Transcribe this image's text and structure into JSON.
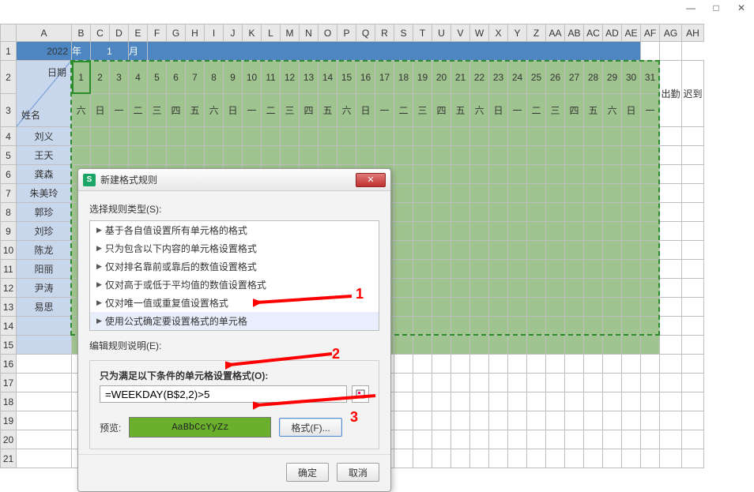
{
  "window_controls": {
    "minimize": "—",
    "maximize": "□",
    "close": "✕"
  },
  "colheaders": [
    "",
    "A",
    "B",
    "C",
    "D",
    "E",
    "F",
    "G",
    "H",
    "I",
    "J",
    "K",
    "L",
    "M",
    "N",
    "O",
    "P",
    "Q",
    "R",
    "S",
    "T",
    "U",
    "V",
    "W",
    "X",
    "Y",
    "Z",
    "AA",
    "AB",
    "AC",
    "AD",
    "AE",
    "AF",
    "AG",
    "AH"
  ],
  "rownums": [
    "1",
    "2",
    "3",
    "4",
    "5",
    "6",
    "7",
    "8",
    "9",
    "10",
    "11",
    "12",
    "13",
    "14",
    "15",
    "16",
    "17",
    "18",
    "19",
    "20",
    "21"
  ],
  "header": {
    "year": "2022",
    "year_suffix": "年",
    "month": "1",
    "month_suffix": "月"
  },
  "diag": {
    "top": "日期",
    "bottom": "姓名"
  },
  "days": [
    "1",
    "2",
    "3",
    "4",
    "5",
    "6",
    "7",
    "8",
    "9",
    "10",
    "11",
    "12",
    "13",
    "14",
    "15",
    "16",
    "17",
    "18",
    "19",
    "20",
    "21",
    "22",
    "23",
    "24",
    "25",
    "26",
    "27",
    "28",
    "29",
    "30",
    "31"
  ],
  "weekdays": [
    "六",
    "日",
    "一",
    "二",
    "三",
    "四",
    "五",
    "六",
    "日",
    "一",
    "二",
    "三",
    "四",
    "五",
    "六",
    "日",
    "一",
    "二",
    "三",
    "四",
    "五",
    "六",
    "日",
    "一",
    "二",
    "三",
    "四",
    "五",
    "六",
    "日",
    "一"
  ],
  "extra_headers": [
    "出勤",
    "迟到"
  ],
  "names": [
    "刘义",
    "王天",
    "龚森",
    "朱美玲",
    "郭珍",
    "刘珍",
    "陈龙",
    "阳丽",
    "尹涛",
    "易思"
  ],
  "dialog": {
    "title": "新建格式规则",
    "section1": "选择规则类型(S):",
    "rules": [
      "基于各自值设置所有单元格的格式",
      "只为包含以下内容的单元格设置格式",
      "仅对排名靠前或靠后的数值设置格式",
      "仅对高于或低于平均值的数值设置格式",
      "仅对唯一值或重复值设置格式",
      "使用公式确定要设置格式的单元格"
    ],
    "section2": "编辑规则说明(E):",
    "group_label": "只为满足以下条件的单元格设置格式(O):",
    "formula": "=WEEKDAY(B$2,2)>5",
    "preview_label": "预览:",
    "preview_sample": "AaBbCcYyZz",
    "format_btn": "格式(F)...",
    "ok": "确定",
    "cancel": "取消"
  },
  "annotations": {
    "n1": "1",
    "n2": "2",
    "n3": "3"
  }
}
